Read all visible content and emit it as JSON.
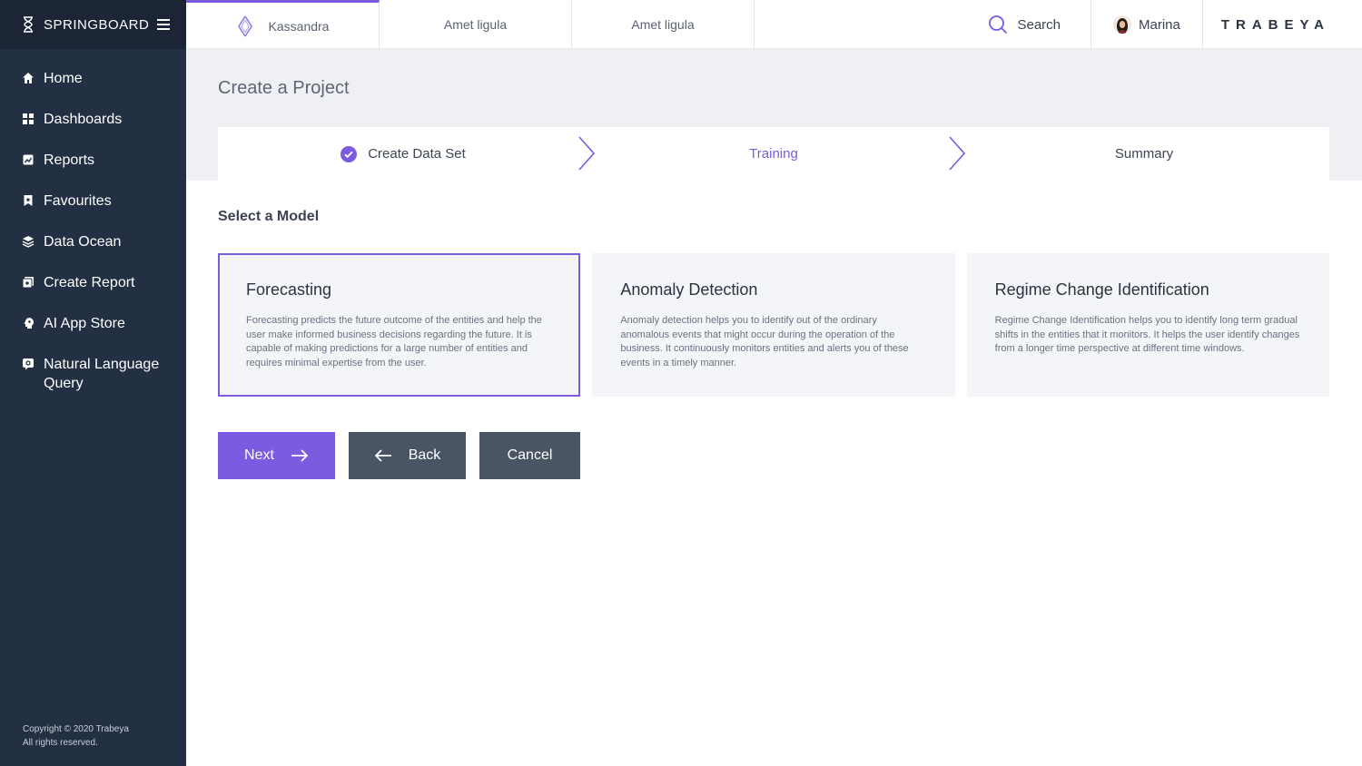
{
  "app": {
    "name": "SPRINGBOARD"
  },
  "sidebar": {
    "items": [
      {
        "label": "Home",
        "icon": "home-icon"
      },
      {
        "label": "Dashboards",
        "icon": "dashboard-icon"
      },
      {
        "label": "Reports",
        "icon": "reports-icon"
      },
      {
        "label": "Favourites",
        "icon": "bookmark-icon"
      },
      {
        "label": "Data Ocean",
        "icon": "layers-icon"
      },
      {
        "label": "Create Report",
        "icon": "create-report-icon"
      },
      {
        "label": "AI App Store",
        "icon": "ai-app-store-icon"
      },
      {
        "label": "Natural Language Query",
        "icon": "nlq-icon"
      }
    ],
    "copyright_line1": "Copyright © 2020 Trabeya",
    "copyright_line2": "All rights reserved."
  },
  "topbar": {
    "tabs": [
      {
        "label": "Kassandra",
        "active": true
      },
      {
        "label": "Amet ligula",
        "active": false
      },
      {
        "label": "Amet ligula",
        "active": false
      }
    ],
    "search_label": "Search",
    "user_name": "Marina",
    "company": "TRABEYA"
  },
  "page": {
    "title": "Create a Project",
    "steps": [
      {
        "label": "Create Data Set",
        "state": "done"
      },
      {
        "label": "Training",
        "state": "current"
      },
      {
        "label": "Summary",
        "state": "upcoming"
      }
    ],
    "section_title": "Select a Model",
    "models": [
      {
        "title": "Forecasting",
        "description": "Forecasting predicts the future outcome of the entities and help the user make informed business decisions regarding the future. It is capable of making predictions for a large number of entities and requires minimal expertise from the user.",
        "selected": true
      },
      {
        "title": "Anomaly Detection",
        "description": "Anomaly detection helps you to identify out of the ordinary anomalous events that might occur during the operation of the business. It continuously monitors entities and alerts you of these events in a timely manner.",
        "selected": false
      },
      {
        "title": "Regime Change Identification",
        "description": "Regime Change Identification helps you to identify long term gradual shifts in the entities that it monitors. It helps the user identify changes from a longer time perspective at different time windows.",
        "selected": false
      }
    ],
    "buttons": {
      "next": "Next",
      "back": "Back",
      "cancel": "Cancel"
    }
  },
  "colors": {
    "accent": "#7b5be0",
    "sidebar": "#232f43",
    "button_dark": "#4a5564"
  }
}
